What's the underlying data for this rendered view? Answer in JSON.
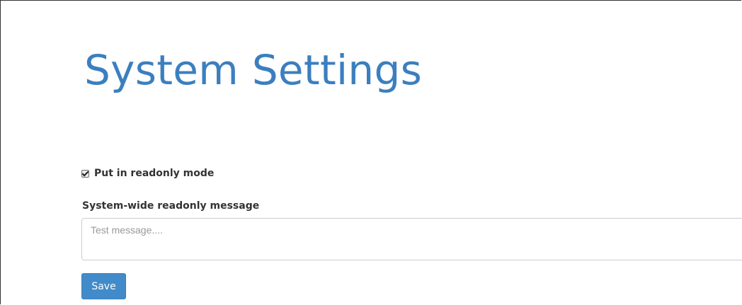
{
  "page": {
    "title": "System Settings"
  },
  "form": {
    "readonly_checkbox": {
      "label": "Put in readonly mode",
      "checked": true
    },
    "message_field": {
      "label": "System-wide readonly message",
      "value": "",
      "placeholder": "Test message...."
    },
    "save_label": "Save"
  },
  "colors": {
    "title": "#3b7fbf",
    "primary_button": "#428bca",
    "label_text": "#333333"
  }
}
